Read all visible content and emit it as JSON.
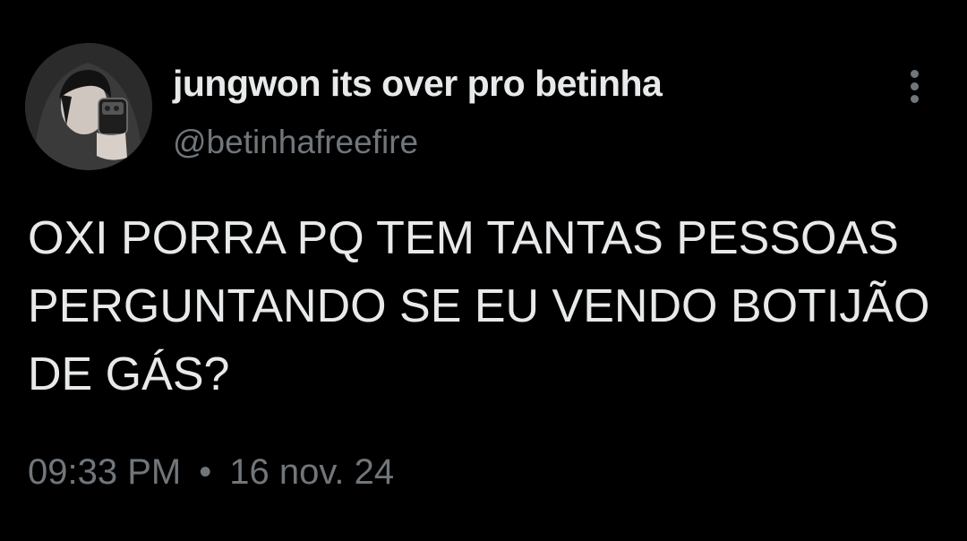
{
  "tweet": {
    "display_name": "jungwon its over pro betinha",
    "handle": "@betinhafreefire",
    "text_lines": [
      "OXI PORRA PQ TEM TANTAS PESSOAS",
      "PERGUNTANDO SE EU VENDO BOTIJÃO",
      "DE GÁS?"
    ],
    "time": "09:33 PM",
    "separator": "•",
    "date": "16 nov. 24"
  },
  "icons": {
    "more": "more-vertical-icon"
  },
  "colors": {
    "background": "#000000",
    "primary_text": "#e7e9ea",
    "secondary_text": "#71767b"
  }
}
